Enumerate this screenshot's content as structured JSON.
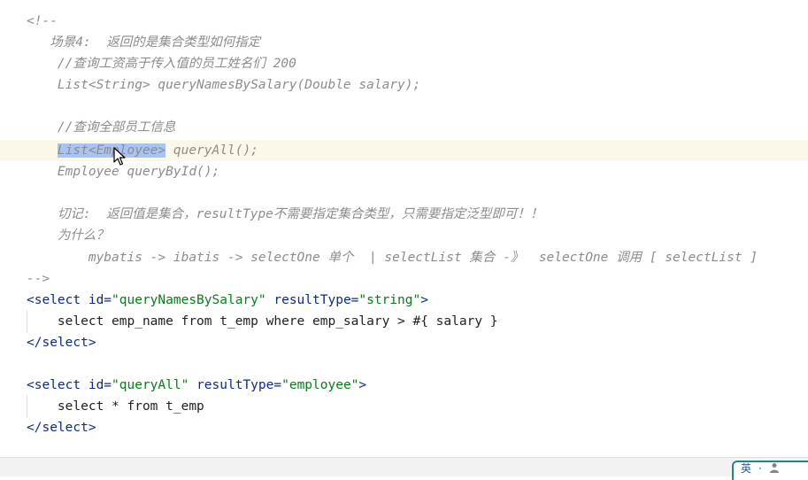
{
  "code": {
    "l1": "<!--",
    "l2": "   场景4:  返回的是集合类型如何指定",
    "l3": "    //查询工资高于传入值的员工姓名们 200",
    "l4": "    List<String> queryNamesBySalary(Double salary);",
    "l5": "",
    "l6": "    //查询全部员工信息",
    "l7_sel": "List<Employee>",
    "l7_rest": " queryAll();",
    "l8": "    Employee queryById();",
    "l9": "",
    "l10": "    切记:  返回值是集合，resultType不需要指定集合类型，只需要指定泛型即可！！",
    "l11": "    为什么？",
    "l12": "        mybatis -> ibatis -> selectOne 单个  | selectList 集合 -》  selectOne 调用 [ selectList ]",
    "l13": "-->",
    "s1_open": "<select",
    "s1_id_attr": " id=",
    "s1_id_val": "\"queryNamesBySalary\"",
    "s1_rt_attr": " resultType=",
    "s1_rt_val": "\"string\"",
    "s1_close": ">",
    "s1_body": "    select emp_name from t_emp where emp_salary > #{ salary }",
    "s1_end": "</select>",
    "s2_open": "<select",
    "s2_id_attr": " id=",
    "s2_id_val": "\"queryAll\"",
    "s2_rt_attr": " resultType=",
    "s2_rt_val": "\"employee\"",
    "s2_close": ">",
    "s2_body": "    select * from t_emp",
    "s2_end": "</select>"
  },
  "ime": {
    "lang_label": "英",
    "dot": "·",
    "user_icon": "user-icon"
  }
}
